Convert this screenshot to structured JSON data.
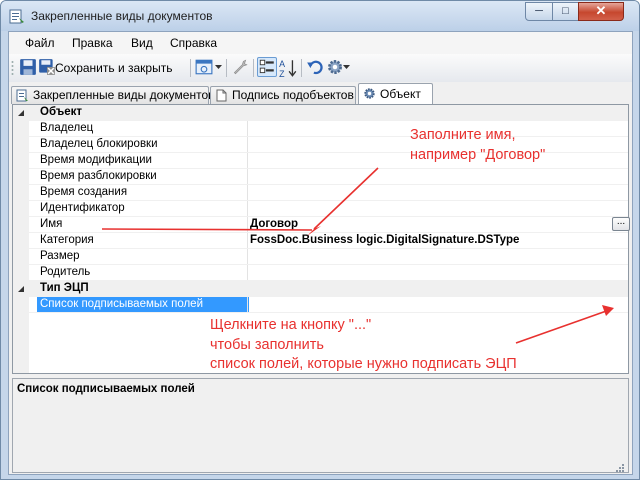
{
  "window": {
    "title": "Закрепленные виды документов",
    "minimize_glyph": "─",
    "maximize_glyph": "□",
    "close_glyph": "✕"
  },
  "menu": [
    "Файл",
    "Правка",
    "Вид",
    "Справка"
  ],
  "toolbar": {
    "save_close_label": "Сохранить и закрыть",
    "icons": [
      "save-icon",
      "save-close-icon",
      "form-icon",
      "dropdown-arrow-icon",
      "tools-icon",
      "categorized-view-icon",
      "alphabetical-sort-icon",
      "undo-icon",
      "gear-icon",
      "dropdown-arrow-icon"
    ]
  },
  "tabs": [
    {
      "label": "Закрепленные виды документов",
      "icon": "document-types-icon",
      "active": false
    },
    {
      "label": "Подпись подобъектов",
      "icon": "page-icon",
      "active": false
    },
    {
      "label": "Объект",
      "icon": "object-gear-icon",
      "active": true
    }
  ],
  "property_grid": {
    "categories": [
      {
        "name": "Объект",
        "rows": [
          {
            "name": "Владелец",
            "value": ""
          },
          {
            "name": "Владелец блокировки",
            "value": ""
          },
          {
            "name": "Время модификации",
            "value": ""
          },
          {
            "name": "Время разблокировки",
            "value": ""
          },
          {
            "name": "Время создания",
            "value": ""
          },
          {
            "name": "Идентификатор",
            "value": ""
          },
          {
            "name": "Имя",
            "value": "Договор"
          },
          {
            "name": "Категория",
            "value": "FossDoc.Business logic.DigitalSignature.DSType"
          },
          {
            "name": "Размер",
            "value": ""
          },
          {
            "name": "Родитель",
            "value": ""
          }
        ]
      },
      {
        "name": "Тип ЭЦП",
        "rows": [
          {
            "name": "Список подписываемых полей",
            "value": "",
            "selected": true
          }
        ]
      }
    ],
    "ellipsis_label": "..."
  },
  "description": {
    "title": "Список подписываемых полей"
  },
  "annotations": {
    "name_hint": [
      "Заполните имя,",
      "например \"Договор\""
    ],
    "button_hint": [
      "Щелкните на кнопку \"...\"",
      "чтобы заполнить",
      "список полей, которые нужно подписать ЭЦП"
    ],
    "color": "#e8312f"
  },
  "colors": {
    "selection": "#3399ff",
    "frame": "#c5d6ea"
  }
}
